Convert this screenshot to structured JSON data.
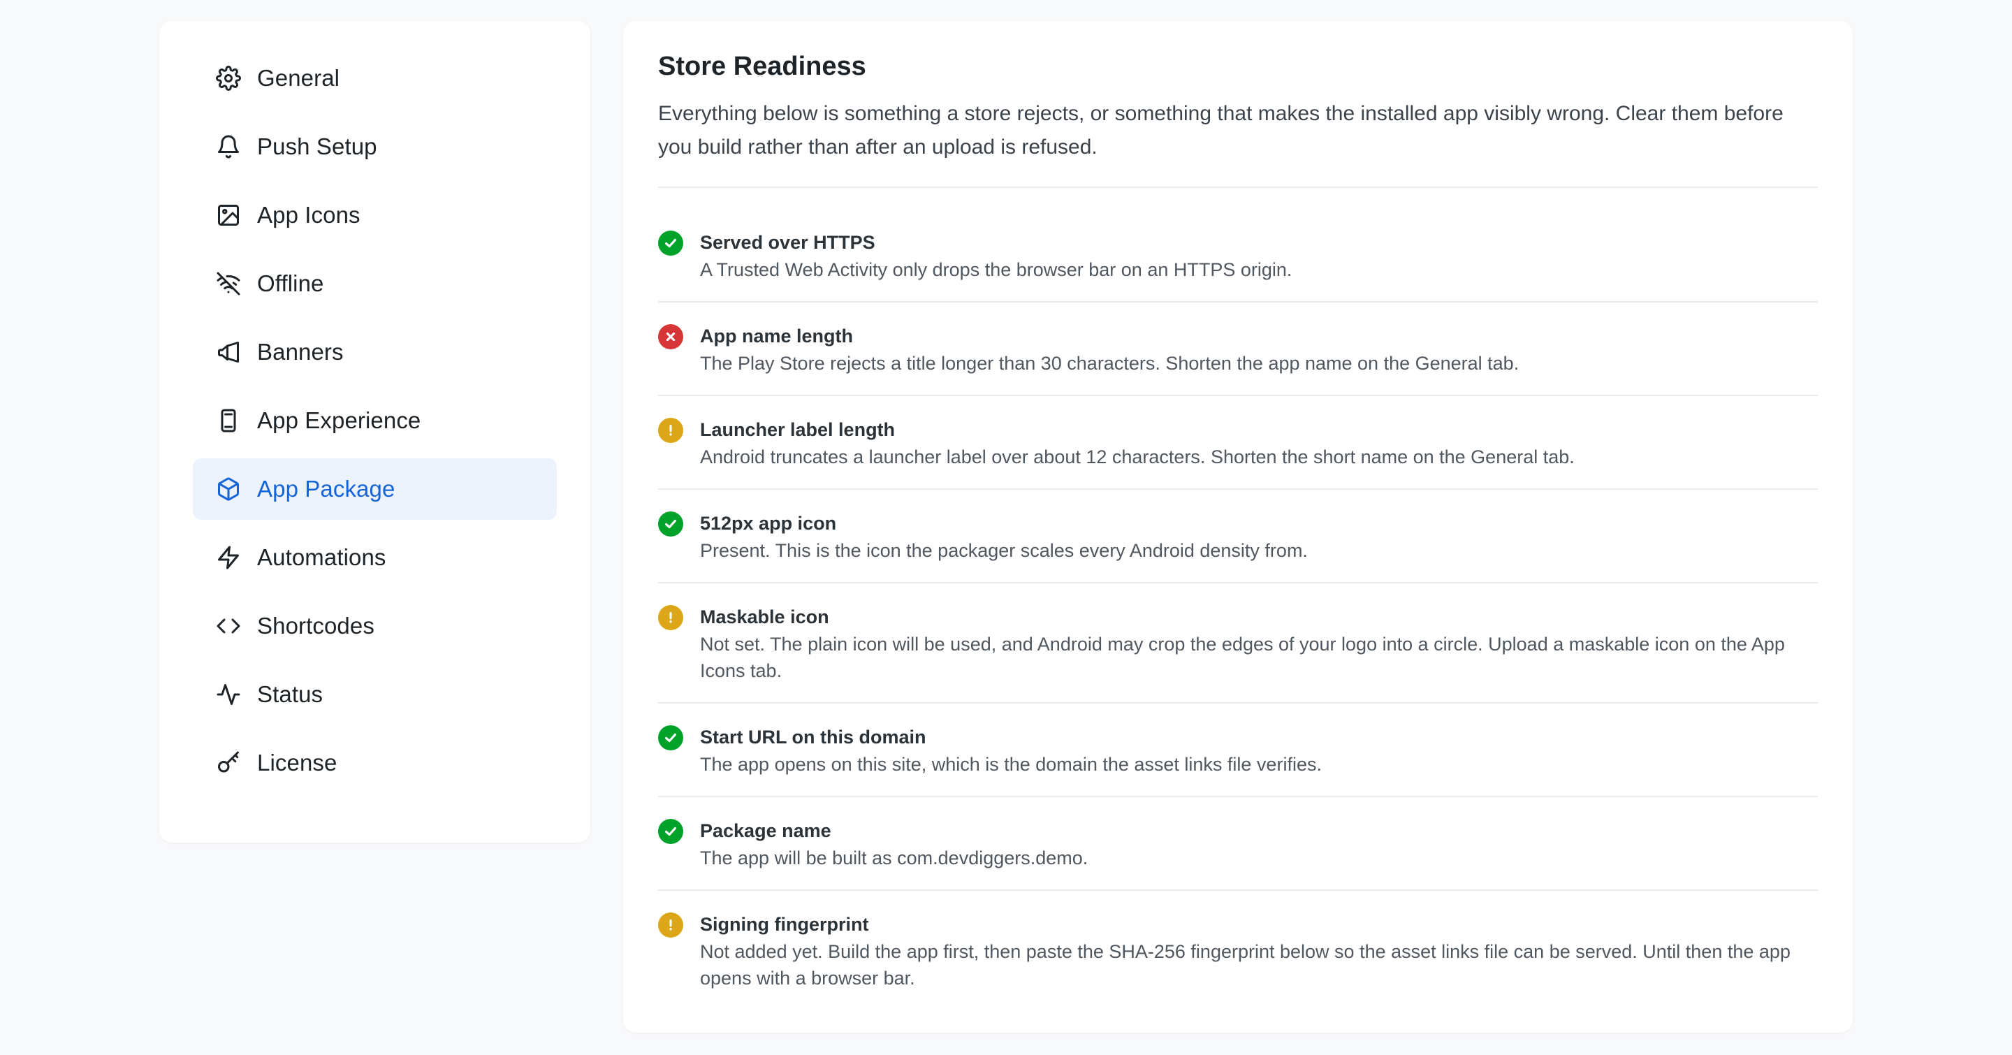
{
  "sidebar": {
    "items": [
      {
        "label": "General",
        "icon": "gear-icon"
      },
      {
        "label": "Push Setup",
        "icon": "bell-icon"
      },
      {
        "label": "App Icons",
        "icon": "image-icon"
      },
      {
        "label": "Offline",
        "icon": "wifi-off-icon"
      },
      {
        "label": "Banners",
        "icon": "megaphone-icon"
      },
      {
        "label": "App Experience",
        "icon": "phone-icon"
      },
      {
        "label": "App Package",
        "icon": "box-icon",
        "active": true
      },
      {
        "label": "Automations",
        "icon": "lightning-icon"
      },
      {
        "label": "Shortcodes",
        "icon": "code-icon"
      },
      {
        "label": "Status",
        "icon": "pulse-icon"
      },
      {
        "label": "License",
        "icon": "key-icon"
      }
    ]
  },
  "main": {
    "title": "Store Readiness",
    "intro": "Everything below is something a store rejects, or something that makes the installed app visibly wrong. Clear them before you build rather than after an upload is refused.",
    "checks": [
      {
        "status": "pass",
        "title": "Served over HTTPS",
        "desc": "A Trusted Web Activity only drops the browser bar on an HTTPS origin."
      },
      {
        "status": "fail",
        "title": "App name length",
        "desc": "The Play Store rejects a title longer than 30 characters. Shorten the app name on the General tab."
      },
      {
        "status": "warn",
        "title": "Launcher label length",
        "desc": "Android truncates a launcher label over about 12 characters. Shorten the short name on the General tab."
      },
      {
        "status": "pass",
        "title": "512px app icon",
        "desc": "Present. This is the icon the packager scales every Android density from."
      },
      {
        "status": "warn",
        "title": "Maskable icon",
        "desc": "Not set. The plain icon will be used, and Android may crop the edges of your logo into a circle. Upload a maskable icon on the App Icons tab."
      },
      {
        "status": "pass",
        "title": "Start URL on this domain",
        "desc": "The app opens on this site, which is the domain the asset links file verifies."
      },
      {
        "status": "pass",
        "title": "Package name",
        "desc": "The app will be built as com.devdiggers.demo."
      },
      {
        "status": "warn",
        "title": "Signing fingerprint",
        "desc": "Not added yet. Build the app first, then paste the SHA-256 fingerprint below so the asset links file can be served. Until then the app opens with a browser bar."
      }
    ]
  },
  "colors": {
    "accent": "#1565d8",
    "active_bg": "#edf3fd",
    "pass": "#00a32a",
    "fail": "#d63638",
    "warn": "#dba617"
  }
}
